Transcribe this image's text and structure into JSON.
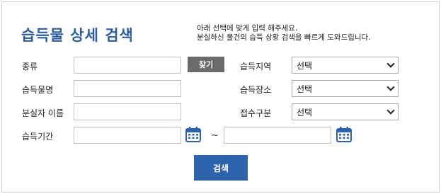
{
  "header": {
    "title": "습득물 상세 검색",
    "description_line1": "아래 선택에 맞게 입력 해주세요.",
    "description_line2": "분실하신 물건의 습득 상황 검색을 빠르게 도와드립니다."
  },
  "form": {
    "type_label": "종류",
    "type_value": "",
    "find_button": "찾기",
    "item_name_label": "습득물명",
    "item_name_value": "",
    "loser_name_label": "분실자 이름",
    "loser_name_value": "",
    "period_label": "습득기간",
    "period_from": "",
    "period_to": "",
    "period_separator": "~",
    "region_label": "습득지역",
    "region_value": "선택",
    "place_label": "습득장소",
    "place_value": "선택",
    "category_label": "접수구분",
    "category_value": "선택",
    "search_button": "검색"
  },
  "icons": {
    "calendar": "calendar-icon",
    "dropdown": "chevron-down-icon"
  },
  "colors": {
    "title": "#2b5e9e",
    "search_button": "#2d62ad",
    "find_button": "#6b6b6b",
    "calendar": "#2d62ad"
  }
}
